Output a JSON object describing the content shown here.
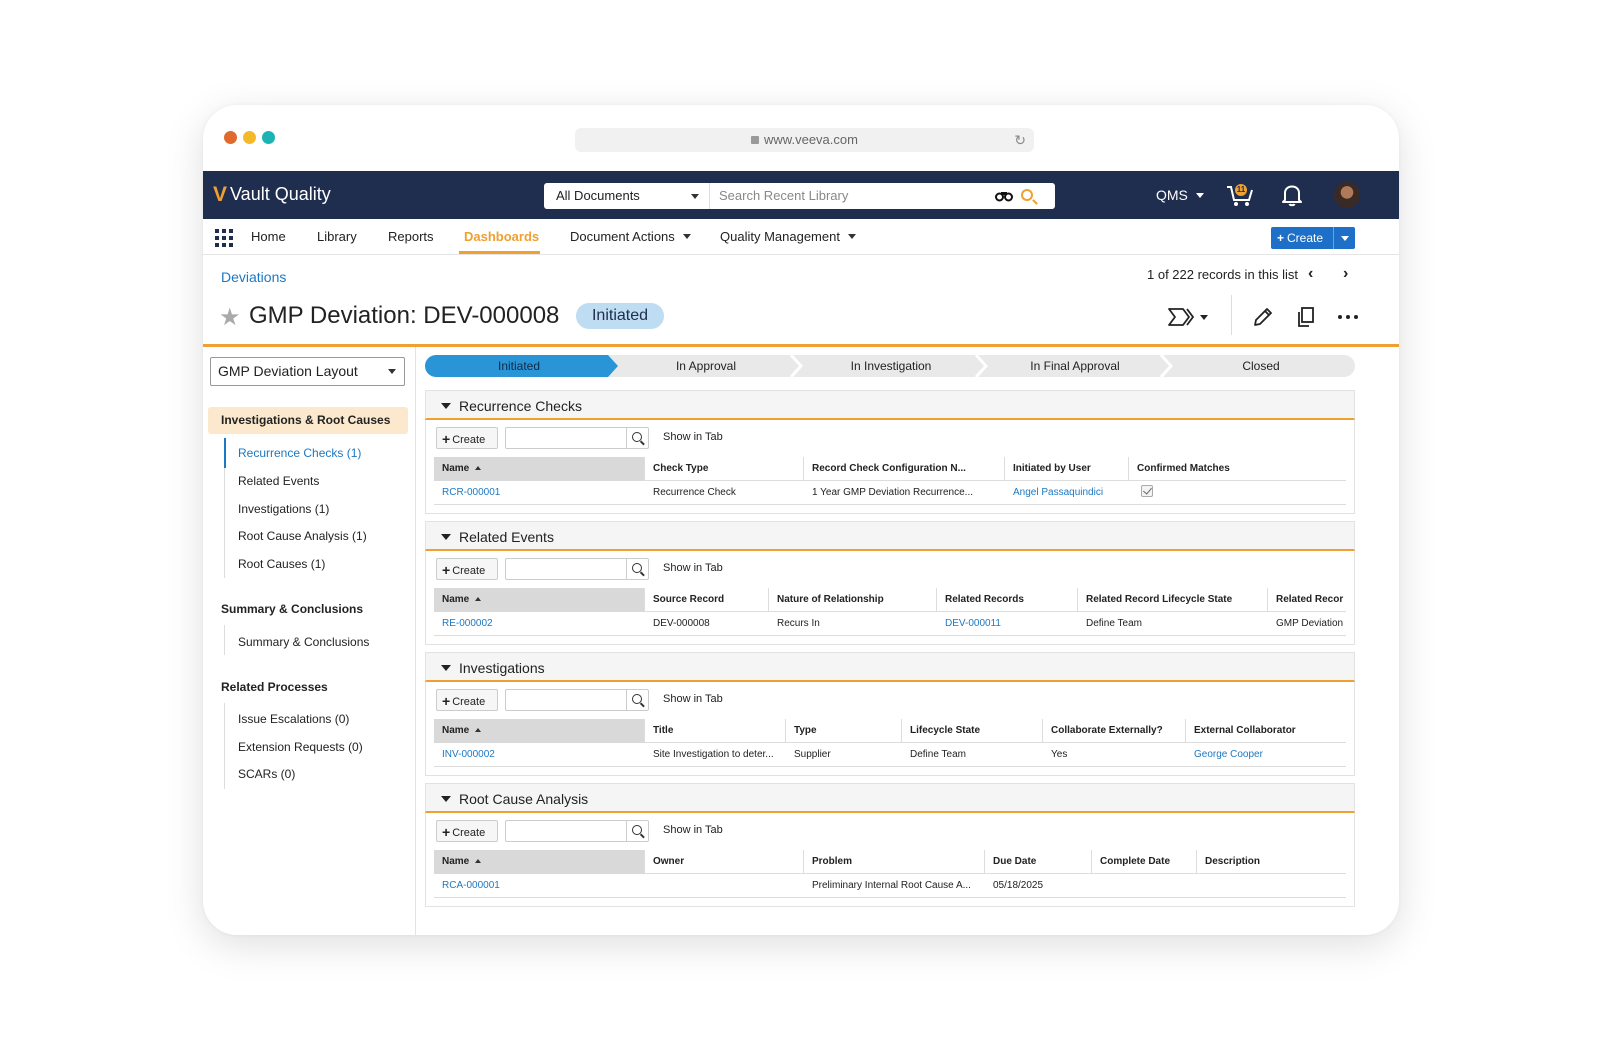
{
  "browser": {
    "url": "www.veeva.com"
  },
  "app": {
    "logo_mark": "V",
    "name": "Vault Quality",
    "search_scope": "All Documents",
    "search_placeholder": "Search Recent Library",
    "app_switch": "QMS",
    "cart_count": "11"
  },
  "nav": {
    "items": [
      "Home",
      "Library",
      "Reports",
      "Dashboards",
      "Document Actions",
      "Quality Management"
    ],
    "active": "Dashboards",
    "create_label": "Create"
  },
  "record": {
    "breadcrumb": "Deviations",
    "pager": "1 of 222 records in this list",
    "title": "GMP Deviation: DEV-000008",
    "state": "Initiated"
  },
  "layout_select": "GMP Deviation Layout",
  "sidebar": {
    "sections": [
      {
        "title": "Investigations & Root Causes",
        "items": [
          "Recurrence Checks (1)",
          "Related Events",
          "Investigations (1)",
          "Root Cause Analysis (1)",
          "Root Causes (1)"
        ]
      },
      {
        "title": "Summary & Conclusions",
        "items": [
          "Summary & Conclusions"
        ]
      },
      {
        "title": "Related Processes",
        "items": [
          "Issue Escalations (0)",
          "Extension Requests (0)",
          "SCARs (0)"
        ]
      }
    ]
  },
  "lifecycle": {
    "stages": [
      "Initiated",
      "In Approval",
      "In Investigation",
      "In Final Approval",
      "Closed"
    ],
    "current": "Initiated"
  },
  "toolbar": {
    "create": "Create",
    "show_in_tab": "Show in Tab"
  },
  "panels": [
    {
      "title": "Recurrence Checks",
      "columns": [
        "Name",
        "Check Type",
        "Record Check Configuration N...",
        "Initiated by User",
        "Confirmed Matches"
      ],
      "row": [
        "RCR-000001",
        "Recurrence Check",
        "1 Year GMP Deviation Recurrence...",
        "Angel Passaquindici",
        ""
      ]
    },
    {
      "title": "Related Events",
      "columns": [
        "Name",
        "Source Record",
        "Nature of Relationship",
        "Related Records",
        "Related Record Lifecycle State",
        "Related Recor"
      ],
      "row": [
        "RE-000002",
        "DEV-000008",
        "Recurs In",
        "DEV-000011",
        "Define Team",
        "GMP Deviation"
      ]
    },
    {
      "title": "Investigations",
      "columns": [
        "Name",
        "Title",
        "Type",
        "Lifecycle State",
        "Collaborate Externally?",
        "External Collaborator"
      ],
      "row": [
        "INV-000002",
        "Site Investigation to deter...",
        "Supplier",
        "Define Team",
        "Yes",
        "George Cooper"
      ]
    },
    {
      "title": "Root Cause Analysis",
      "columns": [
        "Name",
        "Owner",
        "Problem",
        "Due Date",
        "Complete Date",
        "Description"
      ],
      "row": [
        "RCA-000001",
        "",
        "Preliminary Internal Root Cause A...",
        "05/18/2025",
        "",
        ""
      ]
    }
  ],
  "colors": {
    "navy": "#1f2d4e",
    "accent_orange": "#f0a030",
    "link_blue": "#1d78c2",
    "state_badge": "#bedcf2",
    "lifecycle_current": "#2a95d6"
  }
}
